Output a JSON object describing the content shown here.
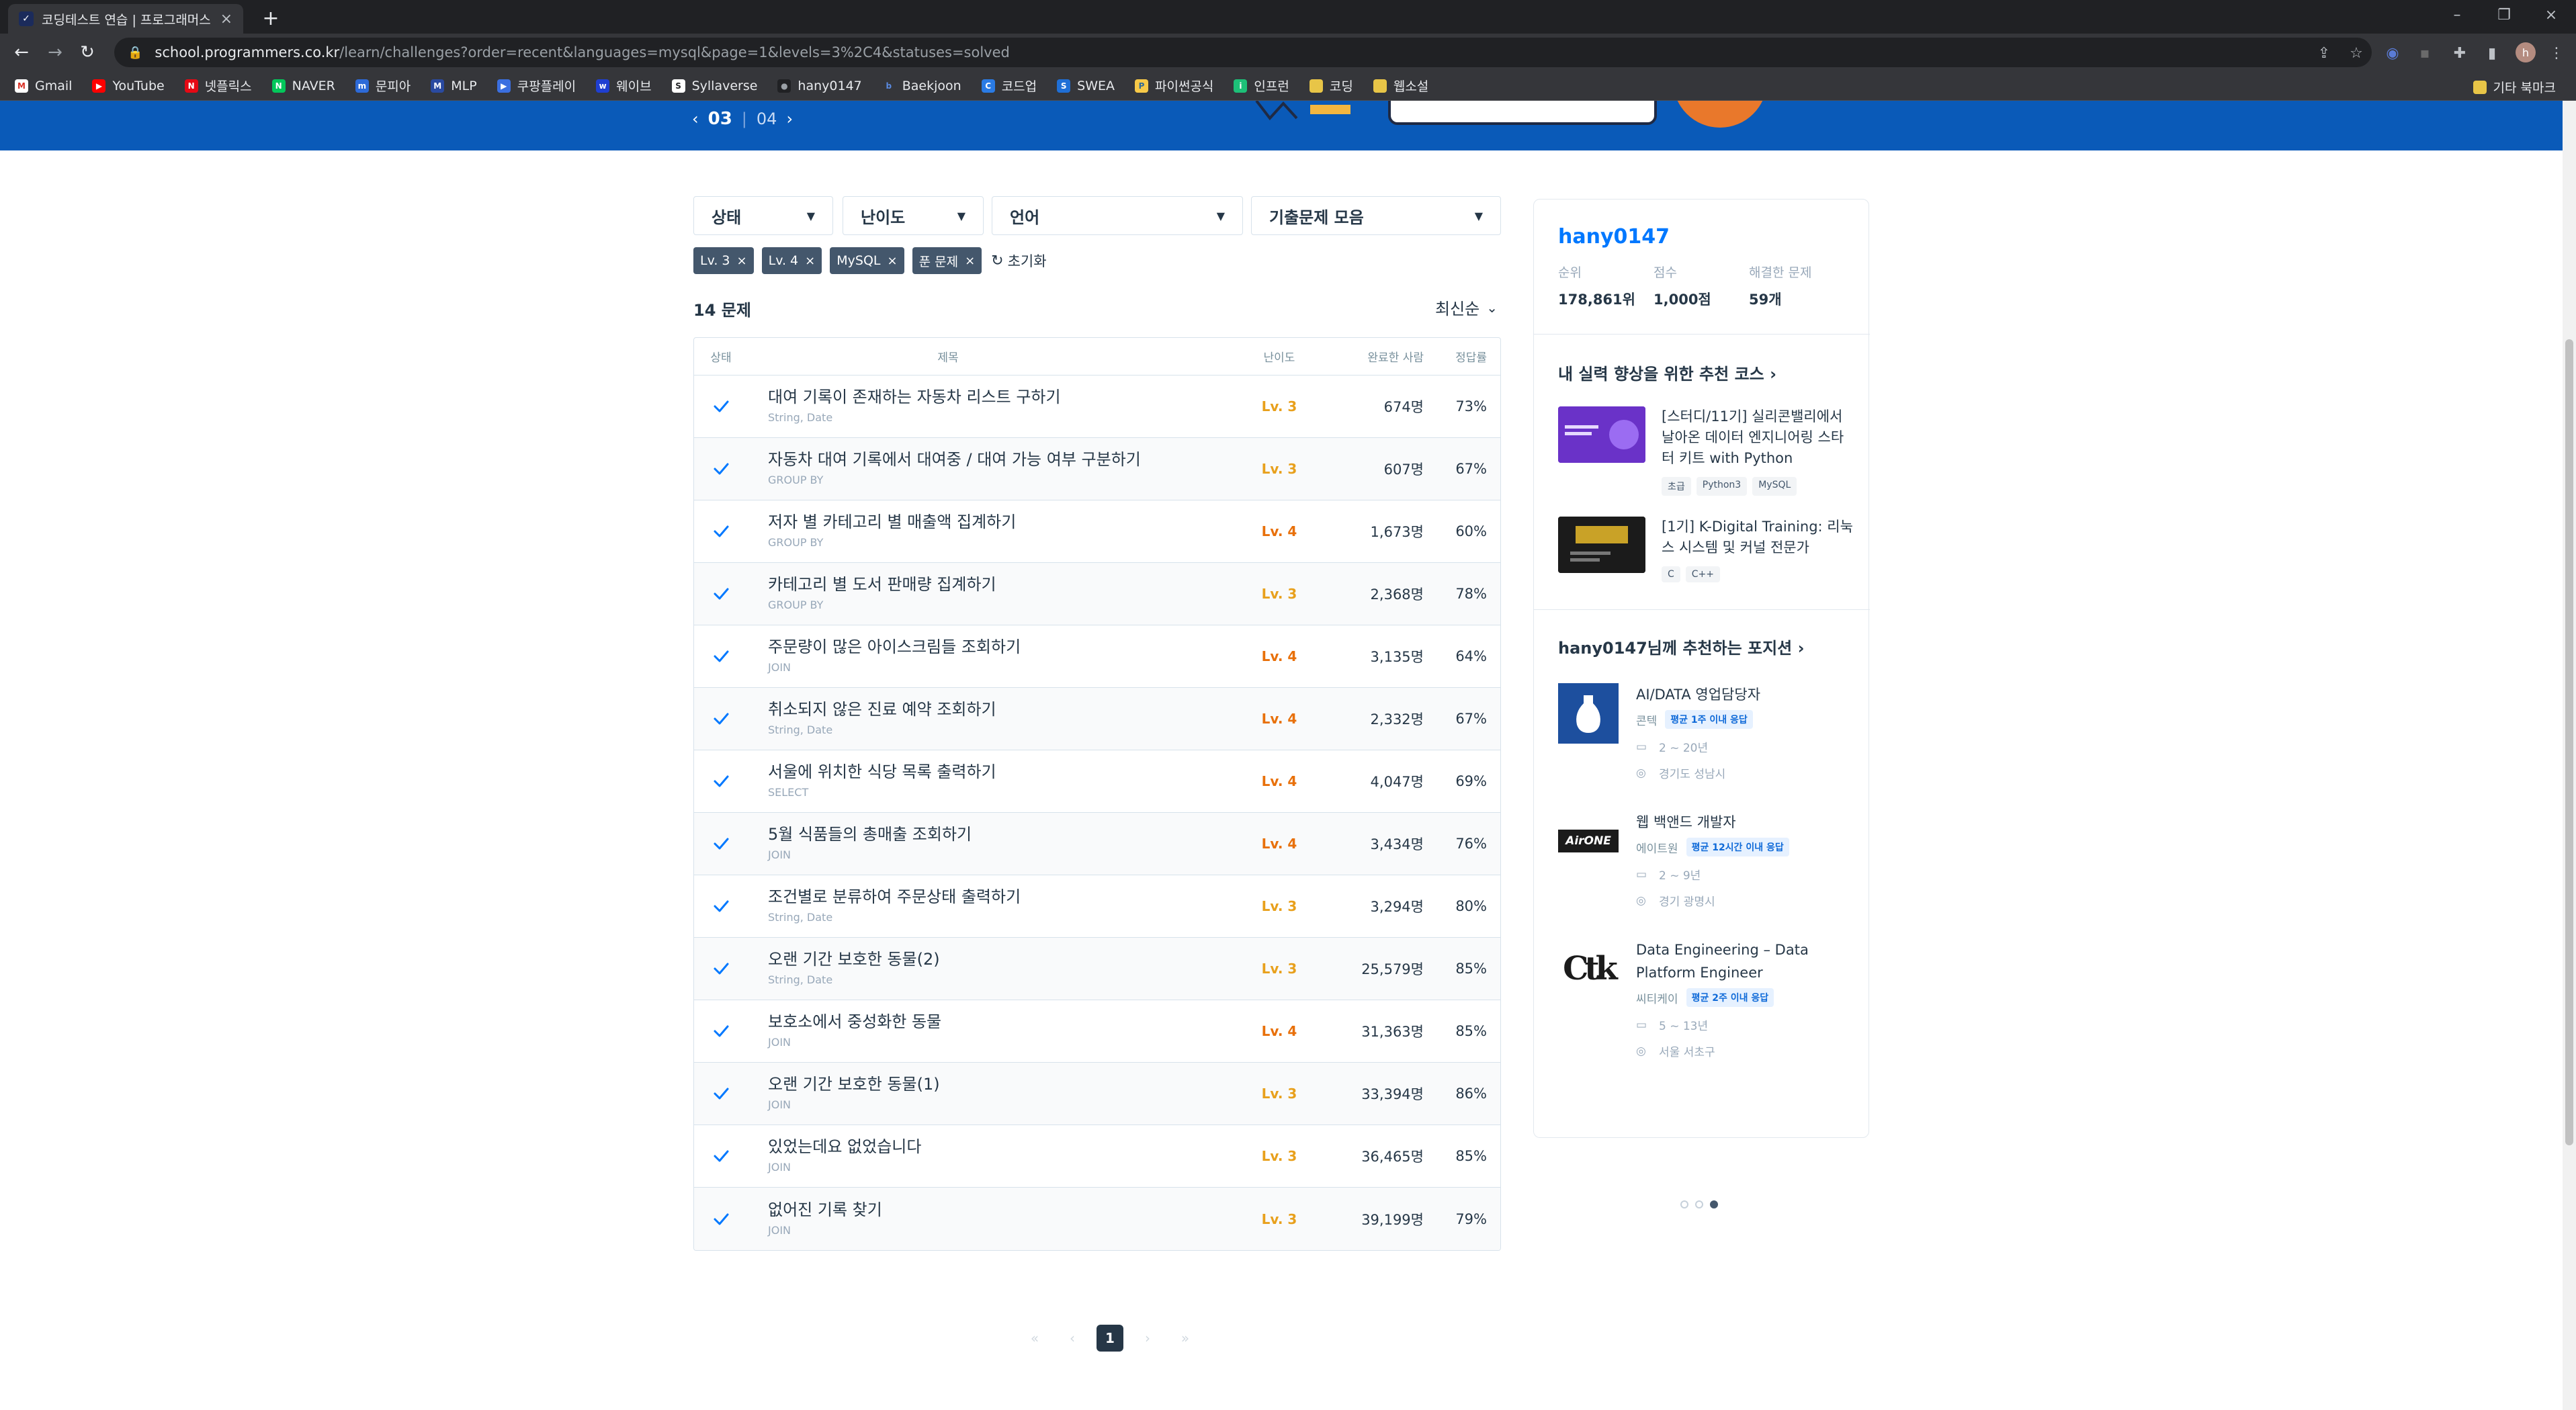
{
  "browser": {
    "tab_title": "코딩테스트 연습 | 프로그래머스",
    "tab_favicon": "programmers-icon",
    "url_host": "school.programmers.co.kr",
    "url_path": "/learn/challenges?order=recent&languages=mysql&page=1&levels=3%2C4&statuses=solved",
    "profile_initial": "h",
    "bookmarks": [
      "Gmail",
      "YouTube",
      "넷플릭스",
      "NAVER",
      "문피아",
      "MLP",
      "쿠팡플레이",
      "웨이브",
      "Syllaverse",
      "hany0147",
      "Baekjoon",
      "코드업",
      "SWEA",
      "파이썬공식",
      "인프런",
      "코딩",
      "웹소설"
    ],
    "bookmarks_other": "기타 북마크"
  },
  "banner": {
    "current": "03",
    "other": "04"
  },
  "filters": {
    "status": "상태",
    "level": "난이도",
    "language": "언어",
    "collection": "기출문제 모음"
  },
  "chips": {
    "items": [
      "Lv. 3",
      "Lv. 4",
      "MySQL",
      "푼 문제"
    ],
    "reset": "초기화"
  },
  "list": {
    "count": "14 문제",
    "sort": "최신순",
    "headers": {
      "state": "상태",
      "title": "제목",
      "level": "난이도",
      "done": "완료한 사람",
      "rate": "정답률"
    },
    "rows": [
      {
        "title": "대여 기록이 존재하는 자동차 리스트 구하기",
        "cat": "String, Date",
        "level": "Lv. 3",
        "done": "674명",
        "rate": "73%"
      },
      {
        "title": "자동차 대여 기록에서 대여중 / 대여 가능 여부 구분하기",
        "cat": "GROUP BY",
        "level": "Lv. 3",
        "done": "607명",
        "rate": "67%"
      },
      {
        "title": "저자 별 카테고리 별 매출액 집계하기",
        "cat": "GROUP BY",
        "level": "Lv. 4",
        "done": "1,673명",
        "rate": "60%"
      },
      {
        "title": "카테고리 별 도서 판매량 집계하기",
        "cat": "GROUP BY",
        "level": "Lv. 3",
        "done": "2,368명",
        "rate": "78%"
      },
      {
        "title": "주문량이 많은 아이스크림들 조회하기",
        "cat": "JOIN",
        "level": "Lv. 4",
        "done": "3,135명",
        "rate": "64%"
      },
      {
        "title": "취소되지 않은 진료 예약 조회하기",
        "cat": "String, Date",
        "level": "Lv. 4",
        "done": "2,332명",
        "rate": "67%"
      },
      {
        "title": "서울에 위치한 식당 목록 출력하기",
        "cat": "SELECT",
        "level": "Lv. 4",
        "done": "4,047명",
        "rate": "69%"
      },
      {
        "title": "5월 식품들의 총매출 조회하기",
        "cat": "JOIN",
        "level": "Lv. 4",
        "done": "3,434명",
        "rate": "76%"
      },
      {
        "title": "조건별로 분류하여 주문상태 출력하기",
        "cat": "String, Date",
        "level": "Lv. 3",
        "done": "3,294명",
        "rate": "80%"
      },
      {
        "title": "오랜 기간 보호한 동물(2)",
        "cat": "String, Date",
        "level": "Lv. 3",
        "done": "25,579명",
        "rate": "85%"
      },
      {
        "title": "보호소에서 중성화한 동물",
        "cat": "JOIN",
        "level": "Lv. 4",
        "done": "31,363명",
        "rate": "85%"
      },
      {
        "title": "오랜 기간 보호한 동물(1)",
        "cat": "JOIN",
        "level": "Lv. 3",
        "done": "33,394명",
        "rate": "86%"
      },
      {
        "title": "있었는데요 없었습니다",
        "cat": "JOIN",
        "level": "Lv. 3",
        "done": "36,465명",
        "rate": "85%"
      },
      {
        "title": "없어진 기록 찾기",
        "cat": "JOIN",
        "level": "Lv. 3",
        "done": "39,199명",
        "rate": "79%"
      }
    ]
  },
  "pagination": {
    "current": "1"
  },
  "sidebar": {
    "username": "hany0147",
    "stats": [
      {
        "label": "순위",
        "value": "178,861위"
      },
      {
        "label": "점수",
        "value": "1,000점"
      },
      {
        "label": "해결한 문제",
        "value": "59개"
      }
    ],
    "course_title": "내 실력 향상을 위한 추천 코스",
    "courses": [
      {
        "name": "[스터디/11기] 실리콘밸리에서 날아온 데이터 엔지니어링 스타터 키트 with Python",
        "tags": [
          "초급",
          "Python3",
          "MySQL"
        ],
        "thumb_text": "데이터 엔지니어링 스타터 키트"
      },
      {
        "name": "[1기] K-Digital Training: 리눅스 시스템 및 커널 전문가",
        "tags": [
          "C",
          "C++"
        ],
        "thumb_text": "LINUX SYSTEM PROGRAMMING"
      }
    ],
    "job_title": "hany0147님께 추천하는 포지션",
    "jobs": [
      {
        "title": "AI/DATA 영업담당자",
        "company": "콘텍",
        "badge": "평균 1주 이내 응답",
        "career": "2 ~ 20년",
        "location": "경기도 성남시"
      },
      {
        "title": "웹 백앤드 개발자",
        "company": "에이트원",
        "badge": "평균 12시간 이내 응답",
        "career": "2 ~ 9년",
        "location": "경기 광명시",
        "logo_text": "AirONE"
      },
      {
        "title": "Data Engineering – Data Platform Engineer",
        "company": "씨티케이",
        "badge": "평균 2주 이내 응답",
        "career": "5 ~ 13년",
        "location": "서울 서초구",
        "logo_text": "Ctk"
      }
    ]
  },
  "colors": {
    "accent": "#0078ff",
    "banner": "#0a5ab8",
    "level3": "#e8a01c",
    "level4": "#e8700a",
    "check": "#0078ff"
  }
}
